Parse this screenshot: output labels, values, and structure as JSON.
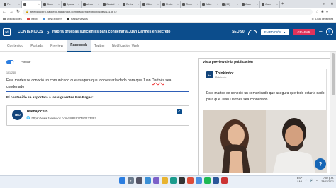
{
  "browser": {
    "tabs": [
      {
        "label": "Pu",
        "icon": "app-icon",
        "active": false
      },
      {
        "label": "",
        "icon": "app-icon",
        "active": true
      },
      {
        "label": "Slack",
        "icon": "slack-icon",
        "active": false
      },
      {
        "label": "Ayuda",
        "icon": "app-icon",
        "active": false
      },
      {
        "label": "alexa",
        "icon": "app-icon",
        "active": false
      },
      {
        "label": "Ciudad",
        "icon": "app-icon",
        "active": false
      },
      {
        "label": "Revisi",
        "icon": "app-icon",
        "active": false
      },
      {
        "label": "Ultim",
        "icon": "app-icon",
        "active": false
      },
      {
        "label": "Photo",
        "icon": "app-icon",
        "active": false
      },
      {
        "label": "Think",
        "icon": "app-icon",
        "active": false
      },
      {
        "label": "Juliet",
        "icon": "app-icon",
        "active": false
      },
      {
        "label": "(90)",
        "icon": "app-icon",
        "active": false
      },
      {
        "label": "Juan",
        "icon": "app-icon",
        "active": false
      },
      {
        "label": "Juan",
        "icon": "app-icon",
        "active": false
      }
    ],
    "url": "telebajocero.backend.thinkindot.com/backend/edition/notes/1315672",
    "bookmarks": [
      "Aplicaciones",
      "Inbox",
      "TBNExplorer",
      "Rass Analytics"
    ],
    "reading_list": "Lista de lectura"
  },
  "app": {
    "logo_text": "td",
    "section": "CONTENIDOS",
    "article_title": "Habría pruebas suficientes para condenar a Juan Darthés en secreto",
    "seo_label": "SEO 90",
    "edition_label": "EN EDICIÓN",
    "save_label": "GRABAR",
    "subtabs": [
      "Contenido",
      "Portada",
      "Preview",
      "Facebook",
      "Twitter",
      "Notificación Web"
    ],
    "active_subtab": "Facebook"
  },
  "facebook": {
    "publish_label": "Publicar",
    "char_count": "101/240",
    "post_text_before": "Este martes se conoció un comunicado que asegura que todo estaría dado para que Juan ",
    "post_text_misspelled": "Darthés",
    "post_text_after": " sea condenado",
    "fanpages_heading": "El contenido se exportara a las siguientes Fan Pages:",
    "page_logo": "TBO",
    "page_name": "Telebajocero",
    "page_url": "https://www.facebook.com/1881917582133392",
    "page_checked": true
  },
  "preview": {
    "heading": "Vista preview de la publicación",
    "avatar_text": "td",
    "page_name": "Thinkindot",
    "page_sub": "Publicado",
    "text": "Este martes se conoció un comunicado que asegura que todo estaría dado para que Juan Darthés sea condenado"
  },
  "taskbar": {
    "language": "ESP",
    "language_sub": "LAA",
    "time": "7:02 p.m.",
    "date": "23/11/2021"
  },
  "colors": {
    "app_bar": "#0c4d8c",
    "save_button": "#e0325a",
    "toggle": "#2b7de0"
  }
}
